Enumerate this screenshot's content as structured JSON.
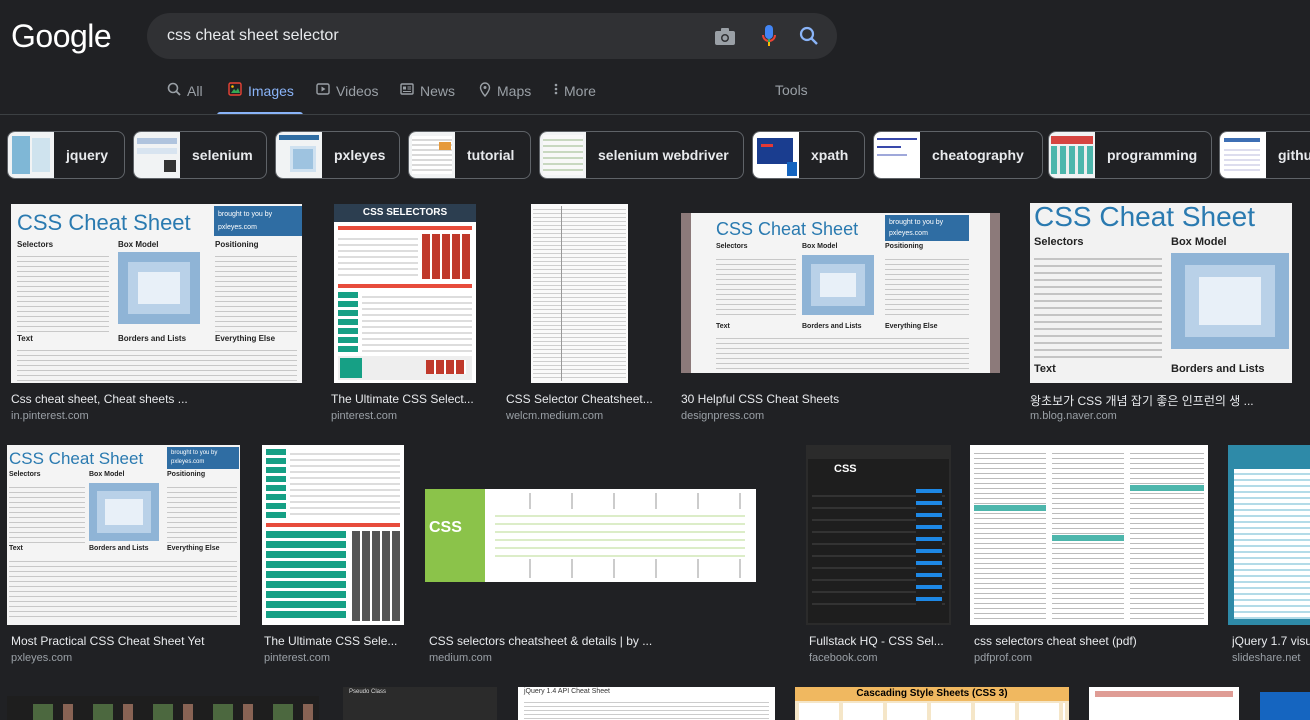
{
  "header": {
    "logo": "Google",
    "search_value": "css cheat sheet selector"
  },
  "tabs": [
    {
      "label": "All",
      "icon": "search-icon"
    },
    {
      "label": "Images",
      "icon": "images-icon"
    },
    {
      "label": "Videos",
      "icon": "video-icon"
    },
    {
      "label": "News",
      "icon": "news-icon"
    },
    {
      "label": "Maps",
      "icon": "map-pin-icon"
    },
    {
      "label": "More",
      "icon": "more-vert-icon"
    }
  ],
  "tools_label": "Tools",
  "chips": [
    {
      "label": "jquery"
    },
    {
      "label": "selenium"
    },
    {
      "label": "pxleyes"
    },
    {
      "label": "tutorial"
    },
    {
      "label": "selenium webdriver"
    },
    {
      "label": "xpath"
    },
    {
      "label": "cheatography"
    },
    {
      "label": "programming"
    },
    {
      "label": "githu"
    }
  ],
  "results": [
    {
      "title": "Css cheat sheet, Cheat sheets ...",
      "source": "in.pinterest.com",
      "thumb_title": "CSS Cheat Sheet",
      "thumb_banner": "brought to you by pxleyes.com",
      "sections": [
        "Selectors",
        "Box Model",
        "Positioning",
        "Text",
        "Borders and Lists",
        "Everything Else"
      ]
    },
    {
      "title": "The Ultimate CSS Select...",
      "source": "pinterest.com",
      "thumb_title": "CSS SELECTORS"
    },
    {
      "title": "CSS Selector Cheatsheet...",
      "source": "welcm.medium.com"
    },
    {
      "title": "30 Helpful CSS Cheat Sheets",
      "source": "designpress.com",
      "thumb_title": "CSS Cheat Sheet",
      "thumb_banner": "brought to you by pxleyes.com",
      "sections": [
        "Selectors",
        "Box Model",
        "Positioning",
        "Text",
        "Borders and Lists",
        "Everything Else"
      ]
    },
    {
      "title": "왕초보가 CSS 개념 잡기 좋은 인프런의 생 ...",
      "source": "m.blog.naver.com",
      "thumb_title": "CSS Cheat Sheet",
      "sections": [
        "Selectors",
        "Box Model",
        "Text",
        "Borders and Lists"
      ]
    },
    {
      "title": "Most Practical CSS Cheat Sheet Yet",
      "source": "pxleyes.com",
      "thumb_title": "CSS Cheat Sheet",
      "thumb_banner": "brought to you by pxleyes.com",
      "sections": [
        "Selectors",
        "Box Model",
        "Positioning",
        "Text",
        "Borders and Lists",
        "Everything Else"
      ]
    },
    {
      "title": "The Ultimate CSS Sele...",
      "source": "pinterest.com"
    },
    {
      "title": "CSS selectors cheatsheet & details | by ...",
      "source": "medium.com",
      "thumb_title": "CSS"
    },
    {
      "title": "Fullstack HQ - CSS Sel...",
      "source": "facebook.com",
      "thumb_title": "CSS"
    },
    {
      "title": "css selectors cheat sheet (pdf)",
      "source": "pdfprof.com"
    },
    {
      "title": "jQuery 1.7 visu",
      "source": "slideshare.net"
    }
  ],
  "bottom_row": [
    {
      "thumb_title": ""
    },
    {
      "thumb_title": "Pseudo Class"
    },
    {
      "thumb_title": "jQuery 1.4 API Cheat Sheet"
    },
    {
      "thumb_title": "Cascading Style Sheets (CSS 3)"
    },
    {
      "thumb_title": ""
    }
  ],
  "colors": {
    "background": "#202124",
    "search_box": "#303134",
    "accent": "#8ab4f8",
    "muted": "#9aa0a6"
  }
}
